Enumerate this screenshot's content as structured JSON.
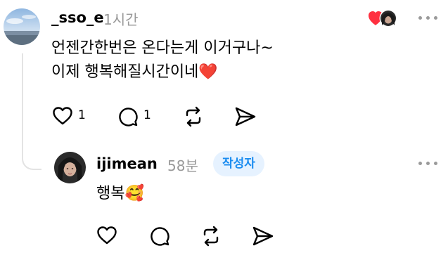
{
  "comment": {
    "username": "_sso_e",
    "time": "1시간",
    "lines": [
      "언젠간한번은 온다는게 이거구나~",
      "이제 행복해질시간이네❤️"
    ],
    "like_count": "1",
    "reply_count": "1",
    "liked_by_author": true
  },
  "reply": {
    "username": "ijimean",
    "time": "58분",
    "author_badge": "작성자",
    "text": "행복🥰"
  },
  "colors": {
    "author_badge_bg": "#e6f2ff",
    "author_badge_text": "#1a8cf0",
    "heart": "#ff3040",
    "muted": "#999999"
  }
}
